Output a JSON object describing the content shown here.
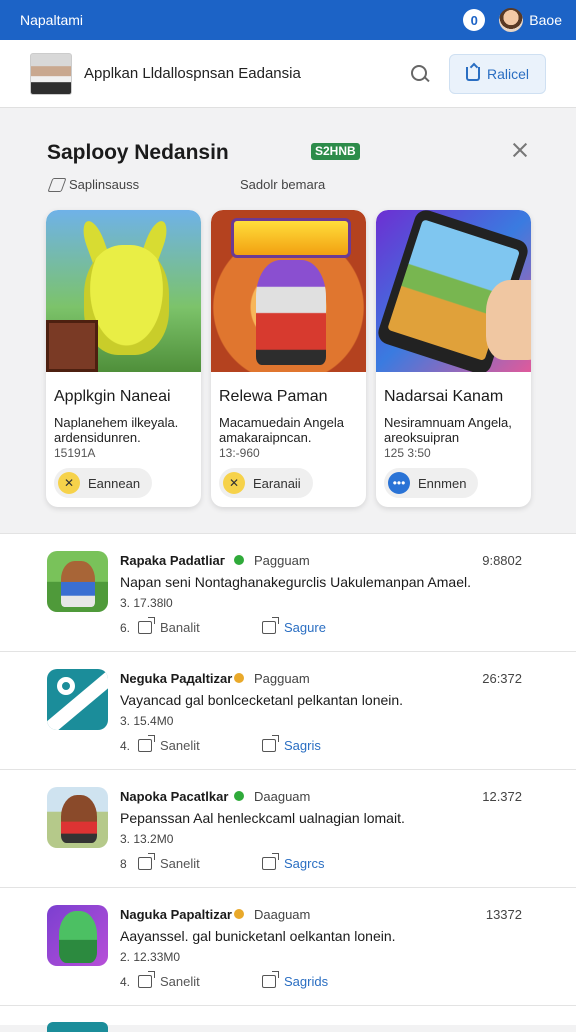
{
  "topbar": {
    "title": "Napaltami",
    "user_name": "Baoe",
    "round_icon_letter": "0"
  },
  "header": {
    "title": "Applkan Lldallospnsan Eadansia",
    "action_label": "Ralicel"
  },
  "featured": {
    "title": "Saploоу Nedansin",
    "badge": "S2HNB",
    "sub_left": "Saplinsauss",
    "sub_right": "Sadolr bemara",
    "cards": [
      {
        "title": "Applkgin Naneai",
        "desc": "Naplanehem ilkeyala. ardensidunren.",
        "meta": "15191A",
        "button": "Eannean",
        "btn_glyph": "✕"
      },
      {
        "title": "Relewa Paman",
        "desc": "Macamuedain Angela amakaraipncan.",
        "meta": "13:-960",
        "button": "Earanaii",
        "btn_glyph": "✕"
      },
      {
        "title": "Nadarsai Kanam",
        "desc": "Nesiramnuam Angela, areoksuipran",
        "meta": "125 3:50",
        "button": "Ennmen",
        "btn_glyph": "•••"
      }
    ]
  },
  "feed": [
    {
      "name": "Rapaka Padatliaг",
      "dot_color": "#2faa3a",
      "tag": "Pagguam",
      "time": "9:8802",
      "text": "Napan seni Nontaghanakegurclis Uakulemanpan Amael.",
      "stats": "3. 17.38l0",
      "count": "6.",
      "action1": "Banalit",
      "action2": "Sagure"
    },
    {
      "name": "Neguka Paдaltizar",
      "dot_color": "#e9a92a",
      "tag": "Pagguam",
      "time": "26:372",
      "text": "Vayancad gal bonlcecketanl pelkantan lonein.",
      "stats": "3. 15.4M0",
      "count": "4.",
      "action1": "Sanelit",
      "action2": "Sagris"
    },
    {
      "name": "Napoka Pacatlkar",
      "dot_color": "#2faa3a",
      "tag": "Daaguam",
      "time": "12.372",
      "text": "Pepanssan Aal henleckcaml ualnagian lomait.",
      "stats": "3. 13.2M0",
      "count": "8",
      "action1": "Sanelit",
      "action2": "Sagrcs"
    },
    {
      "name": "Naguka Papaltizar",
      "dot_color": "#e9a92a",
      "tag": "Daaguam",
      "time": "13372",
      "text": "Aayanssel. gal bunicketanl oelkantan lonein.",
      "stats": "2. 12.33M0",
      "count": "4.",
      "action1": "Sanelit",
      "action2": "Sagrids"
    }
  ]
}
